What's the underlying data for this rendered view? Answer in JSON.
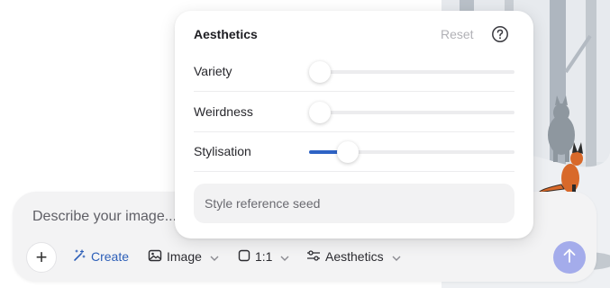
{
  "composer": {
    "placeholder": "Describe your image...",
    "add_label": "+",
    "tools": {
      "create": "Create",
      "image": "Image",
      "ratio": "1:1",
      "aesthetics": "Aesthetics"
    },
    "accent_color": "#2d5fb8",
    "send_color": "#a4aceb"
  },
  "popover": {
    "title": "Aesthetics",
    "reset_label": "Reset",
    "sliders": [
      {
        "label": "Variety",
        "value": 0
      },
      {
        "label": "Weirdness",
        "value": 0
      },
      {
        "label": "Stylisation",
        "value": 0.15
      }
    ],
    "seed_placeholder": "Style reference seed"
  }
}
